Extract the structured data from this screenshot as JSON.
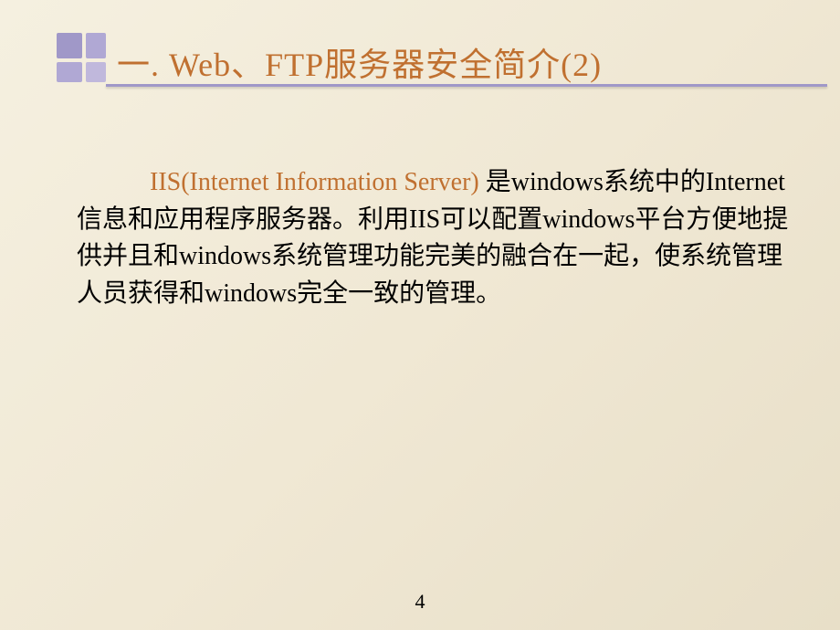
{
  "slide": {
    "title": "一. Web、FTP服务器安全简介(2)",
    "body_highlight": "IIS(Internet Information Server) ",
    "body_text": "是windows系统中的Internet信息和应用程序服务器。利用IIS可以配置windows平台方便地提供并且和windows系统管理功能完美的融合在一起，使系统管理人员获得和windows完全一致的管理。",
    "page_number": "4"
  }
}
